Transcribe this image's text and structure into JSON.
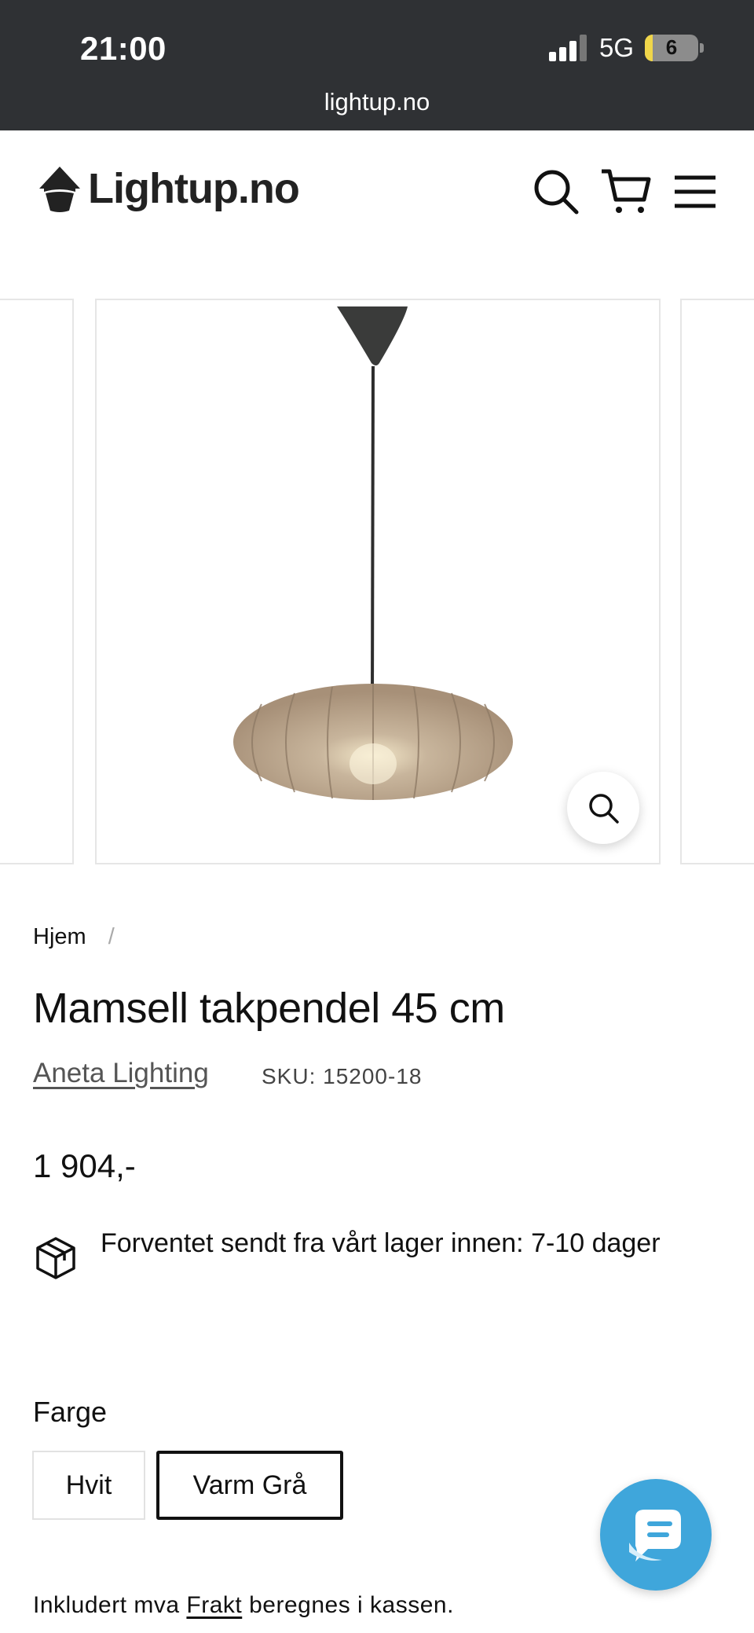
{
  "status_bar": {
    "time": "21:00",
    "network": "5G",
    "battery": "6"
  },
  "browser": {
    "url": "lightup.no"
  },
  "header": {
    "logo_text": "Lightup.no",
    "icons": [
      "search-icon",
      "cart-icon",
      "menu-icon"
    ]
  },
  "gallery": {
    "zoom_icon": "zoom-icon"
  },
  "product": {
    "breadcrumb_home": "Hjem",
    "breadcrumb_sep": "/",
    "title": "Mamsell takpendel 45 cm",
    "vendor": "Aneta Lighting",
    "sku": "SKU: 15200-18",
    "price": "1 904,-",
    "delivery_text": "Forventet sendt fra vårt lager innen: 7-10 dager",
    "option_label": "Farge",
    "options": [
      {
        "label": "Hvit",
        "selected": false
      },
      {
        "label": "Varm Grå",
        "selected": true
      }
    ],
    "tax_prefix": "Inkludert mva",
    "shipping_link": "Frakt",
    "tax_suffix": "beregnes i kassen."
  },
  "colors": {
    "chrome": "#2f3134",
    "chat": "#3fa6db",
    "shade": "#b9a48e"
  }
}
